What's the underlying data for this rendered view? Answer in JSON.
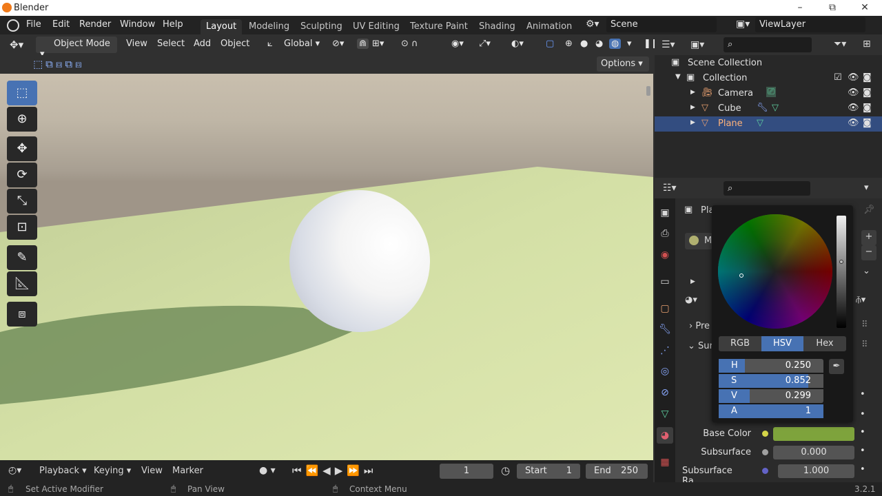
{
  "window": {
    "title": "Blender",
    "min": "–",
    "max": "⧉",
    "close": "✕"
  },
  "menu": {
    "file": "File",
    "edit": "Edit",
    "render": "Render",
    "window": "Window",
    "help": "Help"
  },
  "workspaces": [
    "Layout",
    "Modeling",
    "Sculpting",
    "UV Editing",
    "Texture Paint",
    "Shading",
    "Animation"
  ],
  "scene": {
    "name": "Scene",
    "view_layer": "ViewLayer"
  },
  "viewport_header": {
    "mode": "Object Mode",
    "view": "View",
    "select": "Select",
    "add": "Add",
    "object": "Object",
    "orientation": "Global",
    "options": "Options"
  },
  "outliner": {
    "root": "Scene Collection",
    "collection": "Collection",
    "items": [
      {
        "name": "Camera",
        "color": "#e8a070"
      },
      {
        "name": "Cube",
        "color": "#e8a070"
      },
      {
        "name": "Plane",
        "color": "#e8a070"
      }
    ]
  },
  "properties": {
    "object_label": "Pla",
    "material_label": "M",
    "preview_label": "Pre",
    "surface_label": "Sur",
    "rows": [
      {
        "label": "Base Color",
        "value": "",
        "dot": "#c8c84a"
      },
      {
        "label": "Subsurface",
        "value": "0.000",
        "dot": "#a0a0a0"
      },
      {
        "label": "Subsurface Ra...",
        "value": "1.000",
        "dot": "#6363c7"
      }
    ],
    "base_color_swatch": "#7ea33c"
  },
  "color_picker": {
    "modes": [
      "RGB",
      "HSV",
      "Hex"
    ],
    "active_mode": "HSV",
    "h": {
      "label": "H",
      "value": "0.250",
      "fill": 0.25
    },
    "s": {
      "label": "S",
      "value": "0.852",
      "fill": 0.852
    },
    "v": {
      "label": "V",
      "value": "0.299",
      "fill": 0.299
    },
    "a": {
      "label": "A",
      "value": "1",
      "fill": 1
    }
  },
  "timeline": {
    "playback": "Playback",
    "keying": "Keying",
    "view": "View",
    "marker": "Marker",
    "frame": "1",
    "start_label": "Start",
    "start": "1",
    "end_label": "End",
    "end": "250"
  },
  "status": {
    "left": "Set Active Modifier",
    "mid": "Pan View",
    "right": "Context Menu",
    "version": "3.2.1"
  }
}
